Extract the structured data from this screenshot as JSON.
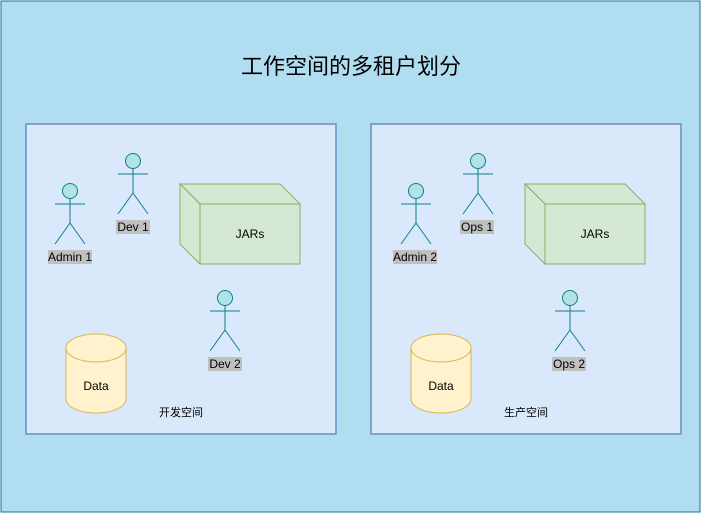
{
  "diagram": {
    "title": "工作空间的多租户划分",
    "colors": {
      "outer_fill": "#b1ddf0",
      "outer_stroke": "#10739e",
      "zone_fill": "#dae8fc",
      "zone_stroke": "#6c8ebf",
      "actor_fill": "#b0e3e6",
      "actor_stroke": "#0e8088",
      "jar_fill": "#d5e8d4",
      "jar_stroke": "#82b366",
      "db_fill": "#fff2cc",
      "db_stroke": "#d6b656",
      "label_bg": "#c0c0c0"
    },
    "zones": [
      {
        "name": "开发空间",
        "actors": [
          "Admin 1",
          "Dev 1",
          "Dev 2"
        ],
        "jar_label": "JARs",
        "db_label": "Data"
      },
      {
        "name": "生产空间",
        "actors": [
          "Admin 2",
          "Ops 1",
          "Ops 2"
        ],
        "jar_label": "JARs",
        "db_label": "Data"
      }
    ]
  }
}
